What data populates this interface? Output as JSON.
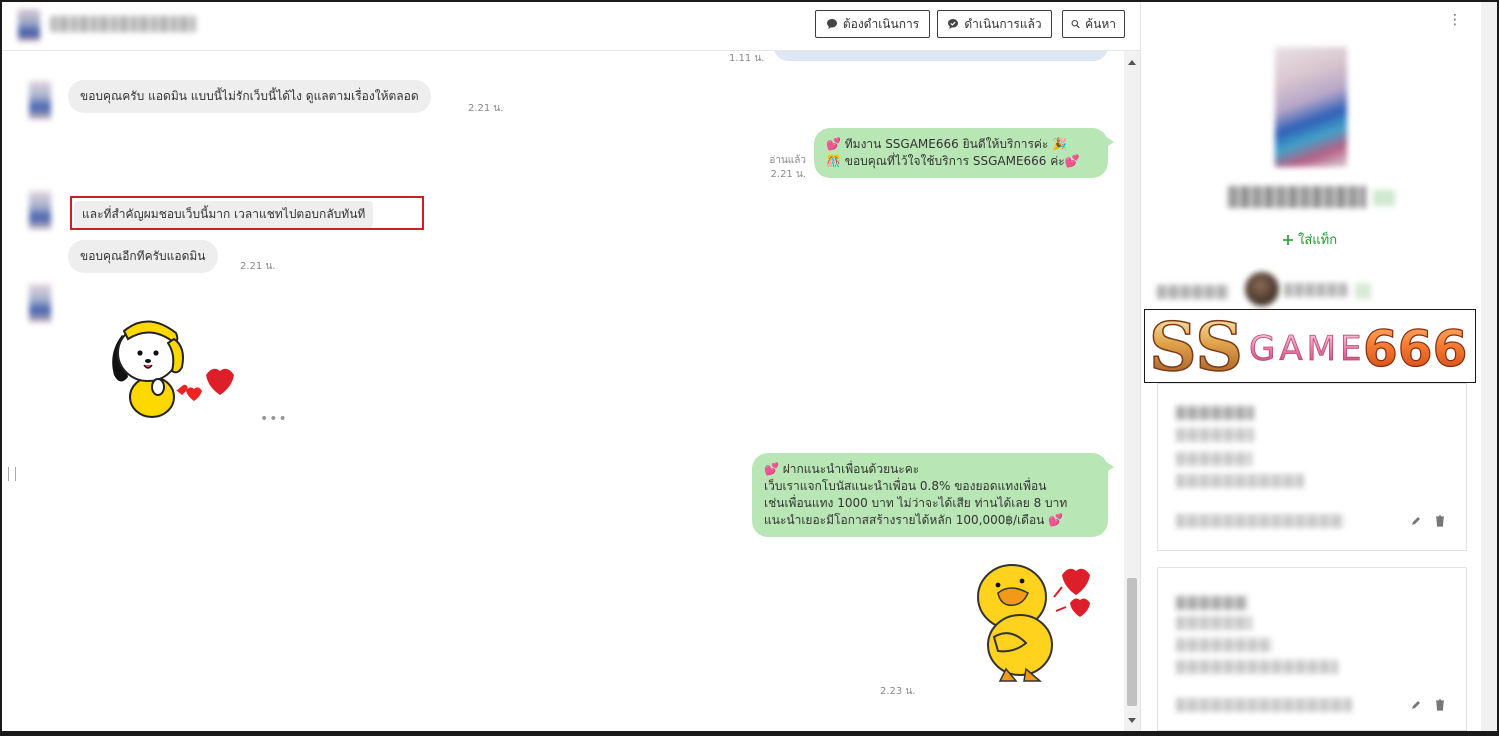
{
  "header": {
    "buttons": [
      {
        "label": "ต้องดำเนินการ",
        "icon": "chat-bubble-icon"
      },
      {
        "label": "ดำเนินการแล้ว",
        "icon": "chat-bubble-check-icon"
      },
      {
        "label": "ค้นหา",
        "icon": "search-icon"
      }
    ]
  },
  "messages": {
    "prev_time": "1.11 น.",
    "in1": {
      "text": "ขอบคุณครับ แอดมิน แบบนี้ไม่รักเว็บนี้ได้ไง ดูแลตามเรื่องให้ตลอด",
      "time": "2.21 น."
    },
    "out1": {
      "line1": "💕 ทีมงาน SSGAME666 ยินดีให้บริการค่ะ 🎉",
      "line2": "🎊 ขอบคุณที่ไว้ใจใช้บริการ SSGAME666 ค่ะ💕",
      "read": "อ่านแล้ว",
      "time": "2.21 น."
    },
    "in2": {
      "text": "และที่สำคัญผมชอบเว็บนี้มาก เวลาแชทไปตอบกลับทันที"
    },
    "in3": {
      "text": "ขอบคุณอีกทีครับแอดมิน",
      "time": "2.21 น."
    },
    "out2": {
      "lines": [
        "💕 ฝากแนะนำเพื่อนด้วยนะคะ",
        "เว็บเราแจกโบนัสแนะนำเพื่อน 0.8% ของยอดแทงเพื่อน",
        "เช่นเพื่อนแทง 1000 บาท ไม่ว่าจะได้เสีย ท่านได้เลย 8 บาท",
        "แนะนำเยอะมีโอกาสสร้างรายได้หลัก 100,000฿/เดือน 💕"
      ]
    },
    "sticker_out_time": "2.23 น.",
    "more_dots": "•••"
  },
  "sidebar": {
    "add_tag": "ใส่แท็ก",
    "kebab": "⋮",
    "logo": {
      "part1": "SS",
      "part2": "GAME",
      "part3": "666"
    }
  },
  "colors": {
    "bubble_in": "#eeeeee",
    "bubble_out": "#b9e6b5",
    "highlight": "#cc1f1f",
    "tag_green": "#1f9b2f"
  }
}
